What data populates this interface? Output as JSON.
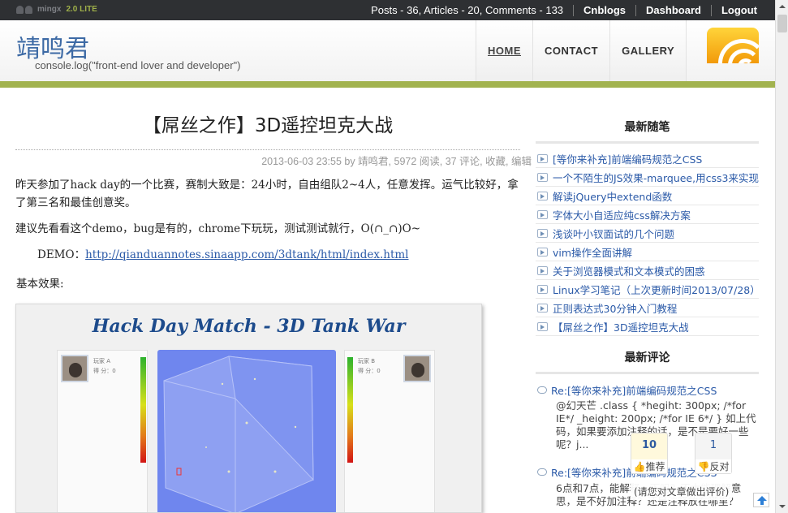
{
  "topbar": {
    "brand_name": "mingx",
    "brand_version": "2.0 LITE",
    "stats": "Posts - 36, Articles - 20, Comments - 133",
    "links": [
      "Cnblogs",
      "Dashboard",
      "Logout"
    ]
  },
  "header": {
    "title": "靖鸣君",
    "subtitle": "console.log(\"front-end lover and developer\")",
    "nav": [
      "HOME",
      "CONTACT",
      "GALLERY"
    ],
    "active_nav": "HOME"
  },
  "post": {
    "title": "【屌丝之作】3D遥控坦克大战",
    "meta": "2013-06-03 23:55 by 靖鸣君, 5972 阅读, 37 评论, 收藏, 编辑",
    "para1": "昨天参加了hack day的一个比赛，赛制大致是：24小时，自由组队2~4人，任意发挥。运气比较好，拿了第三名和最佳创意奖。",
    "para2": "建议先看看这个demo，bug是有的，chrome下玩玩，测试测试就行，O(∩_∩)O~",
    "demo_label": "DEMO：",
    "demo_url": "http://qianduannotes.sinaapp.com/3dtank/html/index.html",
    "para3": "基本效果:",
    "figure": {
      "title": "Hack Day Match - 3D Tank War",
      "player_left": {
        "name": "玩家 A",
        "score": "得 分：0"
      },
      "player_right": {
        "name": "玩家 B",
        "score": "得 分：0"
      }
    }
  },
  "sidebar": {
    "recent_posts_heading": "最新随笔",
    "recent_posts": [
      "[等你来补充]前端编码规范之CSS",
      "一个不陌生的JS效果-marquee,用css3来实现",
      "解读jQuery中extend函数",
      "字体大小自适应纯css解决方案",
      "浅谈叶小钗面试的几个问题",
      "vim操作全面讲解",
      "关于浏览器模式和文本模式的困惑",
      "Linux学习笔记（上次更新时间2013/07/28）",
      "正则表达式30分钟入门教程",
      "【屌丝之作】3D遥控坦克大战"
    ],
    "recent_comments_heading": "最新评论",
    "comments": [
      {
        "title": "Re:[等你来补充]前端编码规范之CSS",
        "body": "@幻天芒 .class { *hegiht: 300px; /*for IE*/ _height: 200px; /*for IE 6*/ } 如上代码，如果要添加注释的话，是不是要好一些呢？j..."
      },
      {
        "title": "Re:[等你来补充]前端编码规范之CSS",
        "body": "6点和7点，能解释一下吗？不太能理解意思，是不好加注释？还是注释放在哪里？"
      }
    ]
  },
  "votes": {
    "up_count": "10",
    "up_label": "推荐",
    "down_count": "1",
    "down_label": "反对",
    "tip": "(请您对文章做出评价)"
  }
}
